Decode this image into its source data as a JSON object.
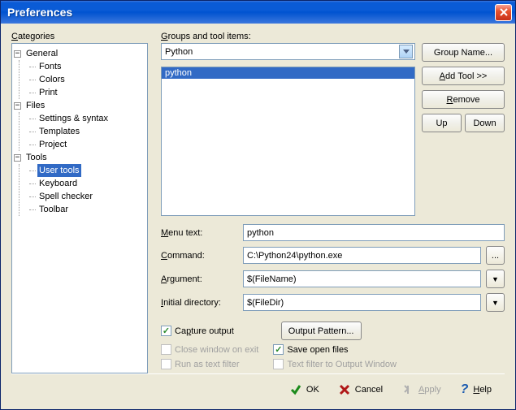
{
  "window": {
    "title": "Preferences"
  },
  "categories": {
    "label": "Categories",
    "tree": [
      {
        "label": "General",
        "expanded": true,
        "children": [
          {
            "label": "Fonts"
          },
          {
            "label": "Colors"
          },
          {
            "label": "Print"
          }
        ]
      },
      {
        "label": "Files",
        "expanded": true,
        "children": [
          {
            "label": "Settings & syntax"
          },
          {
            "label": "Templates"
          },
          {
            "label": "Project"
          }
        ]
      },
      {
        "label": "Tools",
        "expanded": true,
        "children": [
          {
            "label": "User tools",
            "selected": true
          },
          {
            "label": "Keyboard"
          },
          {
            "label": "Spell checker"
          },
          {
            "label": "Toolbar"
          }
        ]
      }
    ]
  },
  "groups": {
    "label": "Groups and tool items:",
    "combo_value": "Python",
    "list": [
      "python"
    ],
    "btn_group": "Group Name...",
    "btn_add": "Add Tool >>",
    "btn_remove": "Remove",
    "btn_up": "Up",
    "btn_down": "Down"
  },
  "form": {
    "menu_text": {
      "label": "Menu text:",
      "value": "python"
    },
    "command": {
      "label": "Command:",
      "value": "C:\\Python24\\python.exe"
    },
    "argument": {
      "label": "Argument:",
      "value": "$(FileName)"
    },
    "initial_dir": {
      "label": "Initial directory:",
      "value": "$(FileDir)"
    }
  },
  "checks": {
    "capture": {
      "label": "Capture output",
      "checked": true,
      "enabled": true
    },
    "output_pattern": "Output Pattern...",
    "close_on_exit": {
      "label": "Close window on exit",
      "checked": false,
      "enabled": false
    },
    "save_open": {
      "label": "Save open files",
      "checked": true,
      "enabled": true
    },
    "text_filter": {
      "label": "Run as text filter",
      "checked": false,
      "enabled": false
    },
    "text_filter_out": {
      "label": "Text filter to Output Window",
      "checked": false,
      "enabled": false
    }
  },
  "footer": {
    "ok": "OK",
    "cancel": "Cancel",
    "apply": "Apply",
    "help": "Help"
  }
}
